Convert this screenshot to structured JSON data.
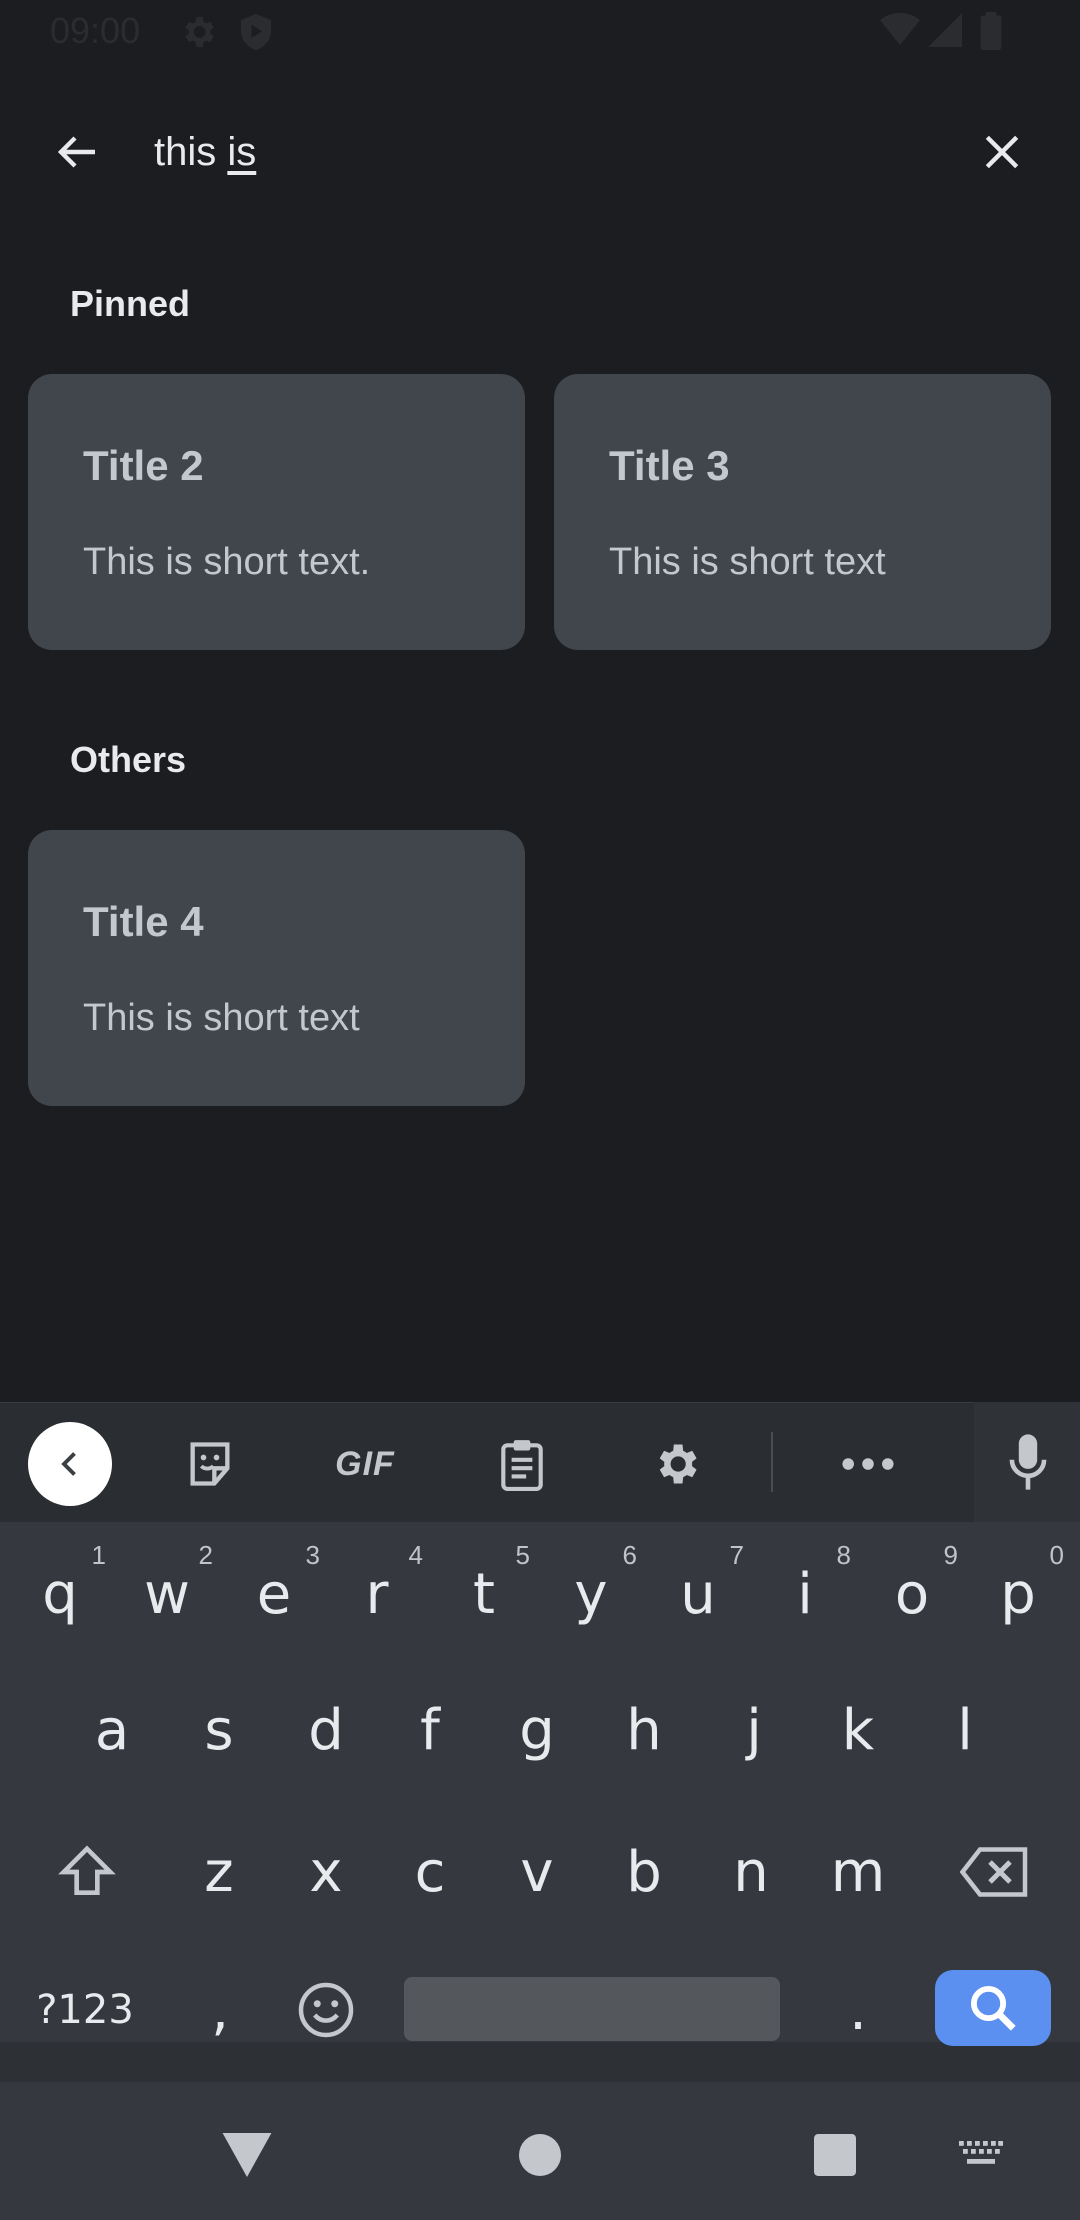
{
  "status_bar": {
    "time": "09:00"
  },
  "search": {
    "query_prefix": "this ",
    "query_underlined": "is"
  },
  "sections": {
    "pinned_label": "Pinned",
    "others_label": "Others"
  },
  "notes": {
    "pinned": [
      {
        "title": "Title 2",
        "body": "This is short text."
      },
      {
        "title": "Title 3",
        "body": "This is short text"
      }
    ],
    "others": [
      {
        "title": "Title 4",
        "body": "This is short text"
      }
    ]
  },
  "keyboard": {
    "toolbar": {
      "gif_label": "GIF"
    },
    "row1": [
      {
        "k": "q",
        "h": "1"
      },
      {
        "k": "w",
        "h": "2"
      },
      {
        "k": "e",
        "h": "3"
      },
      {
        "k": "r",
        "h": "4"
      },
      {
        "k": "t",
        "h": "5"
      },
      {
        "k": "y",
        "h": "6"
      },
      {
        "k": "u",
        "h": "7"
      },
      {
        "k": "i",
        "h": "8"
      },
      {
        "k": "o",
        "h": "9"
      },
      {
        "k": "p",
        "h": "0"
      }
    ],
    "row2": [
      "a",
      "s",
      "d",
      "f",
      "g",
      "h",
      "j",
      "k",
      "l"
    ],
    "row3": [
      "z",
      "x",
      "c",
      "v",
      "b",
      "n",
      "m"
    ],
    "symbols_label": "?123",
    "comma": ",",
    "period": "."
  },
  "colors": {
    "background": "#1b1d20",
    "card": "#41464d",
    "accent": "#5b8ff0"
  }
}
